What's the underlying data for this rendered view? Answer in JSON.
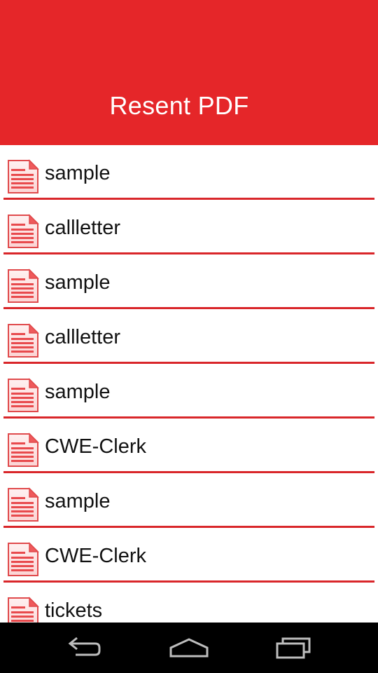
{
  "header": {
    "title": "Resent PDF"
  },
  "files": [
    {
      "name": "sample"
    },
    {
      "name": "callletter"
    },
    {
      "name": "sample"
    },
    {
      "name": "callletter"
    },
    {
      "name": "sample"
    },
    {
      "name": "CWE-Clerk"
    },
    {
      "name": "sample"
    },
    {
      "name": "CWE-Clerk"
    },
    {
      "name": "tickets"
    }
  ],
  "icons": {
    "file": "pdf-document-icon",
    "back": "back-icon",
    "home": "home-icon",
    "recents": "recent-apps-icon"
  },
  "colors": {
    "accent": "#e52629",
    "divider": "#d9262a",
    "navbar": "#000000"
  }
}
